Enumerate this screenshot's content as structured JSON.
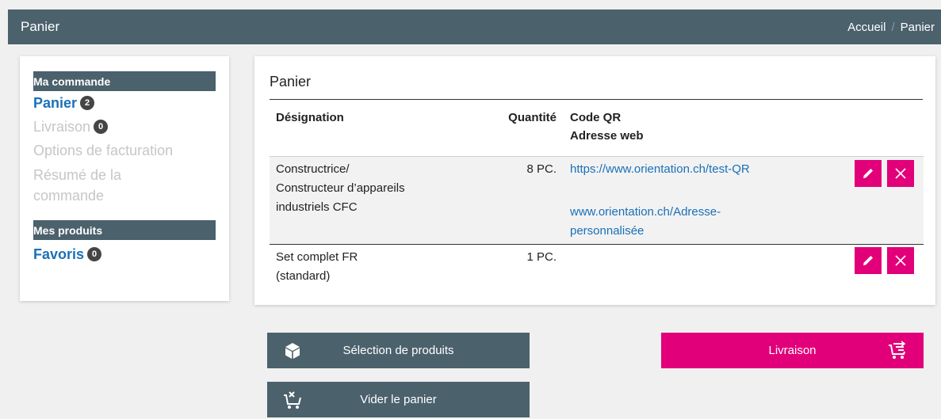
{
  "header": {
    "title": "Panier",
    "breadcrumb": {
      "home": "Accueil",
      "separator": "/",
      "current": "Panier"
    }
  },
  "sidebar": {
    "section1": "Ma commande",
    "items": [
      {
        "label": "Panier",
        "badge": "2",
        "state": "active"
      },
      {
        "label": "Livraison",
        "badge": "0",
        "state": "disabled"
      },
      {
        "label": "Options de facturation",
        "state": "disabled"
      },
      {
        "label": "Résumé de la commande",
        "state": "disabled"
      }
    ],
    "section2": "Mes produits",
    "favorites": {
      "label": "Favoris",
      "badge": "0"
    }
  },
  "cart": {
    "title": "Panier",
    "columns": {
      "designation": "Désignation",
      "quantity": "Quantité",
      "qr_line1": "Code QR",
      "qr_line2": "Adresse web"
    },
    "rows": [
      {
        "designation_lines": [
          "Constructrice/",
          "Constructeur d’appareils",
          "industriels CFC"
        ],
        "quantity": "8 PC.",
        "qr_url": "https://www.orientation.ch/test-QR",
        "web_lines": [
          "www.orientation.ch/Adresse-",
          "personnalisée"
        ]
      },
      {
        "designation_lines": [
          "Set complet FR",
          "(standard)"
        ],
        "quantity": "1 PC."
      }
    ]
  },
  "buttons": {
    "products": "Sélection de produits",
    "delivery": "Livraison",
    "empty": "Vider le panier"
  },
  "colors": {
    "header_bg": "#4b616c",
    "accent_pink": "#e2007a",
    "link_blue": "#1a70b8"
  }
}
